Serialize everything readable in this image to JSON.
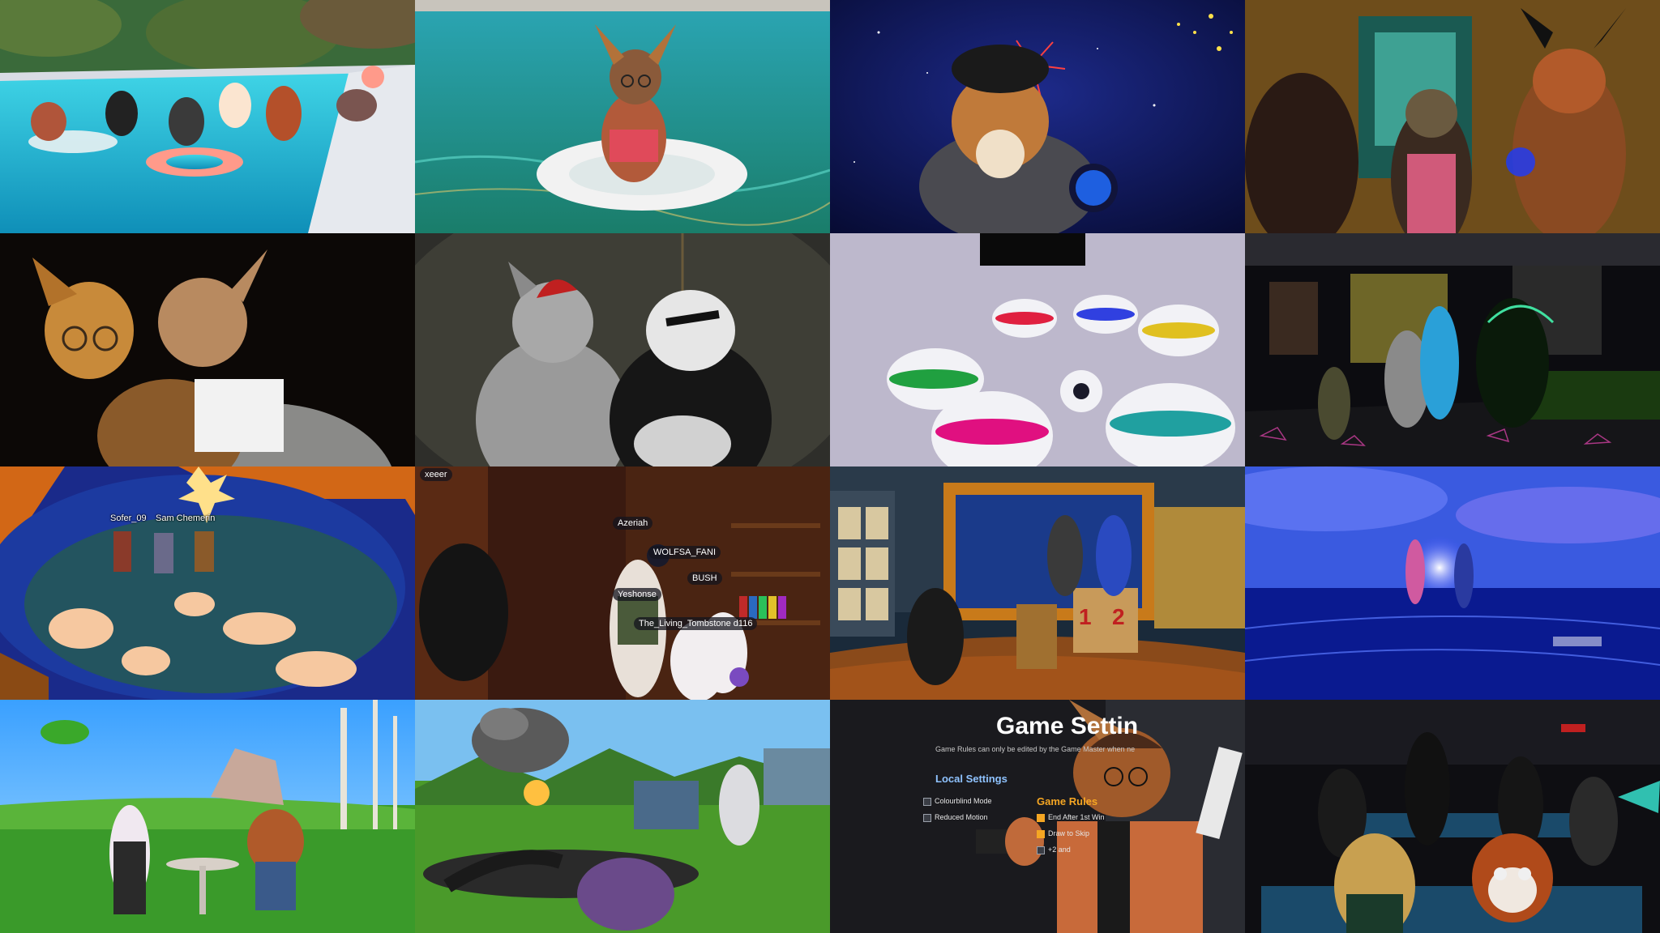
{
  "tiles": {
    "globe": {
      "names": [
        "Sofer_09",
        "Sam Chemerin"
      ]
    },
    "library": {
      "tags": [
        "xeeer",
        "Azeriah",
        "The_Living_Tombstone d116",
        "Yeshonse",
        "WOLFSA_FANI",
        "BUSH"
      ]
    },
    "gameshow": {
      "podiums": [
        "1",
        "2"
      ]
    },
    "settings": {
      "title": "Game Settin",
      "subtitle": "Game Rules can only be edited by the Game Master when ne",
      "local_heading": "Local Settings",
      "local_options": [
        "Colourblind Mode",
        "Reduced Motion"
      ],
      "rules_heading": "Game Rules",
      "rules_options": [
        "End After 1st Win",
        "Draw to Skip",
        "+2 and"
      ]
    }
  }
}
